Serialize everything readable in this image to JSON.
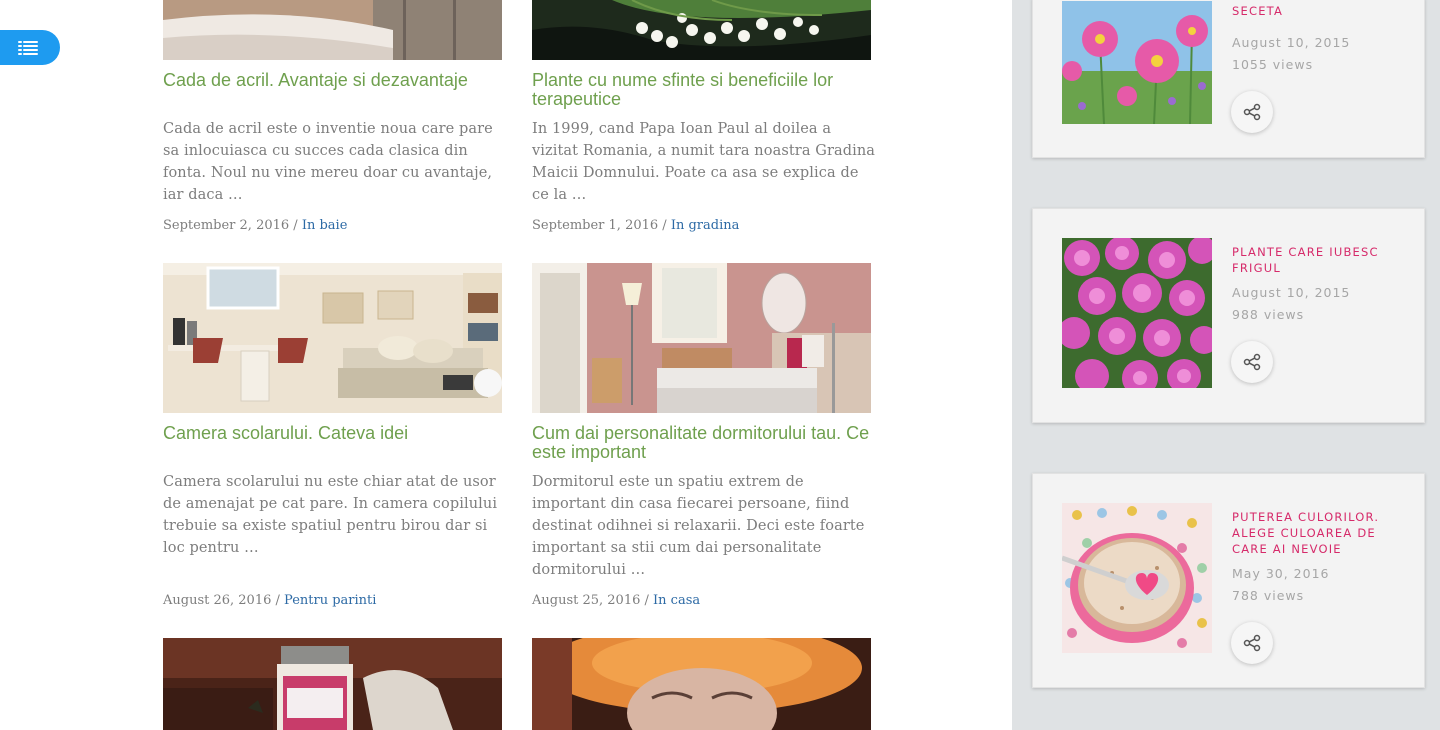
{
  "nav": {
    "menu_icon": "list-menu-icon"
  },
  "posts": [
    {
      "title": "Cada de acril. Avantaje si dezavantaje",
      "excerpt": "Cada de acril este o inventie noua care pare sa inlocuiasca cu succes cada clasica din fonta. Noul nu vine mereu doar cu avantaje, iar daca …",
      "date": "September 2, 2016",
      "category": "In baie"
    },
    {
      "title": "Plante cu nume sfinte si beneficiile lor terapeutice",
      "excerpt": "In 1999, cand Papa Ioan Paul al doilea a vizitat Romania, a numit tara noastra Gradina Maicii Domnului. Poate ca asa se explica de ce la …",
      "date": "September 1, 2016",
      "category": "In gradina"
    },
    {
      "title": "Camera scolarului. Cateva idei",
      "excerpt": "Camera scolarului nu este chiar atat de usor de amenajat pe cat pare. In camera copilului trebuie sa existe spatiul pentru birou dar si loc pentru …",
      "date": "August 26, 2016",
      "category": "Pentru parinti"
    },
    {
      "title": "Cum dai personalitate dormitorului tau. Ce este important",
      "excerpt": "Dormitorul este un spatiu extrem de important din casa fiecarei persoane, fiind destinat odihnei si relaxarii. Deci este foarte important sa stii cum dai personalitate dormitorului …",
      "date": "August 25, 2016",
      "category": "In casa"
    }
  ],
  "meta_separator": "/",
  "sidebar": {
    "cards": [
      {
        "title": "PLANTE LA SOARE SI SECETA",
        "date": "August 10, 2015",
        "views": "1055 views",
        "share_icon": "share-icon"
      },
      {
        "title": "PLANTE CARE IUBESC FRIGUL",
        "date": "August 10, 2015",
        "views": "988 views",
        "share_icon": "share-icon"
      },
      {
        "title": "PUTEREA CULORILOR. ALEGE CULOAREA DE CARE AI NEVOIE",
        "date": "May 30, 2016",
        "views": "788 views",
        "share_icon": "share-icon"
      }
    ]
  },
  "colors": {
    "title_green": "#6fa04e",
    "link_blue": "#2d6aa5",
    "sidebar_pink": "#d62a6a",
    "menu_blue": "#1e9bf0"
  }
}
